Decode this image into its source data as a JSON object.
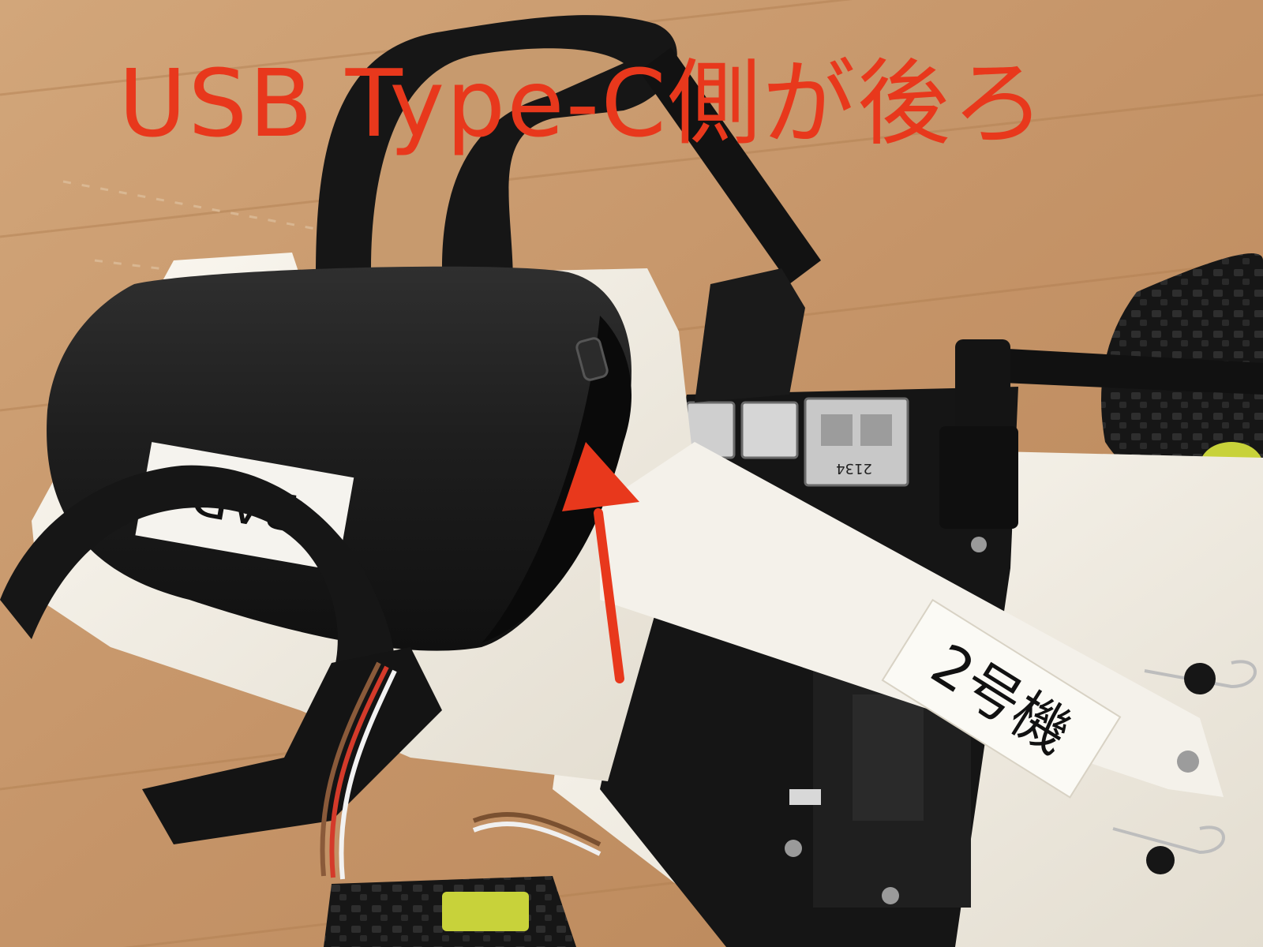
{
  "annotation": {
    "text": "USB Type-C側が後ろ",
    "color": "#e8381c"
  },
  "labels": {
    "unit_tag": "2号機",
    "battery_tag": "BAD",
    "port_marking": "2134"
  },
  "colors": {
    "wood_floor": "#c79a6e",
    "battery_body": "#1c1c1c",
    "chassis_white": "#f2efe8",
    "tire": "#141414",
    "wheel_hub": "#c8d23a",
    "arrow": "#e8381c"
  }
}
